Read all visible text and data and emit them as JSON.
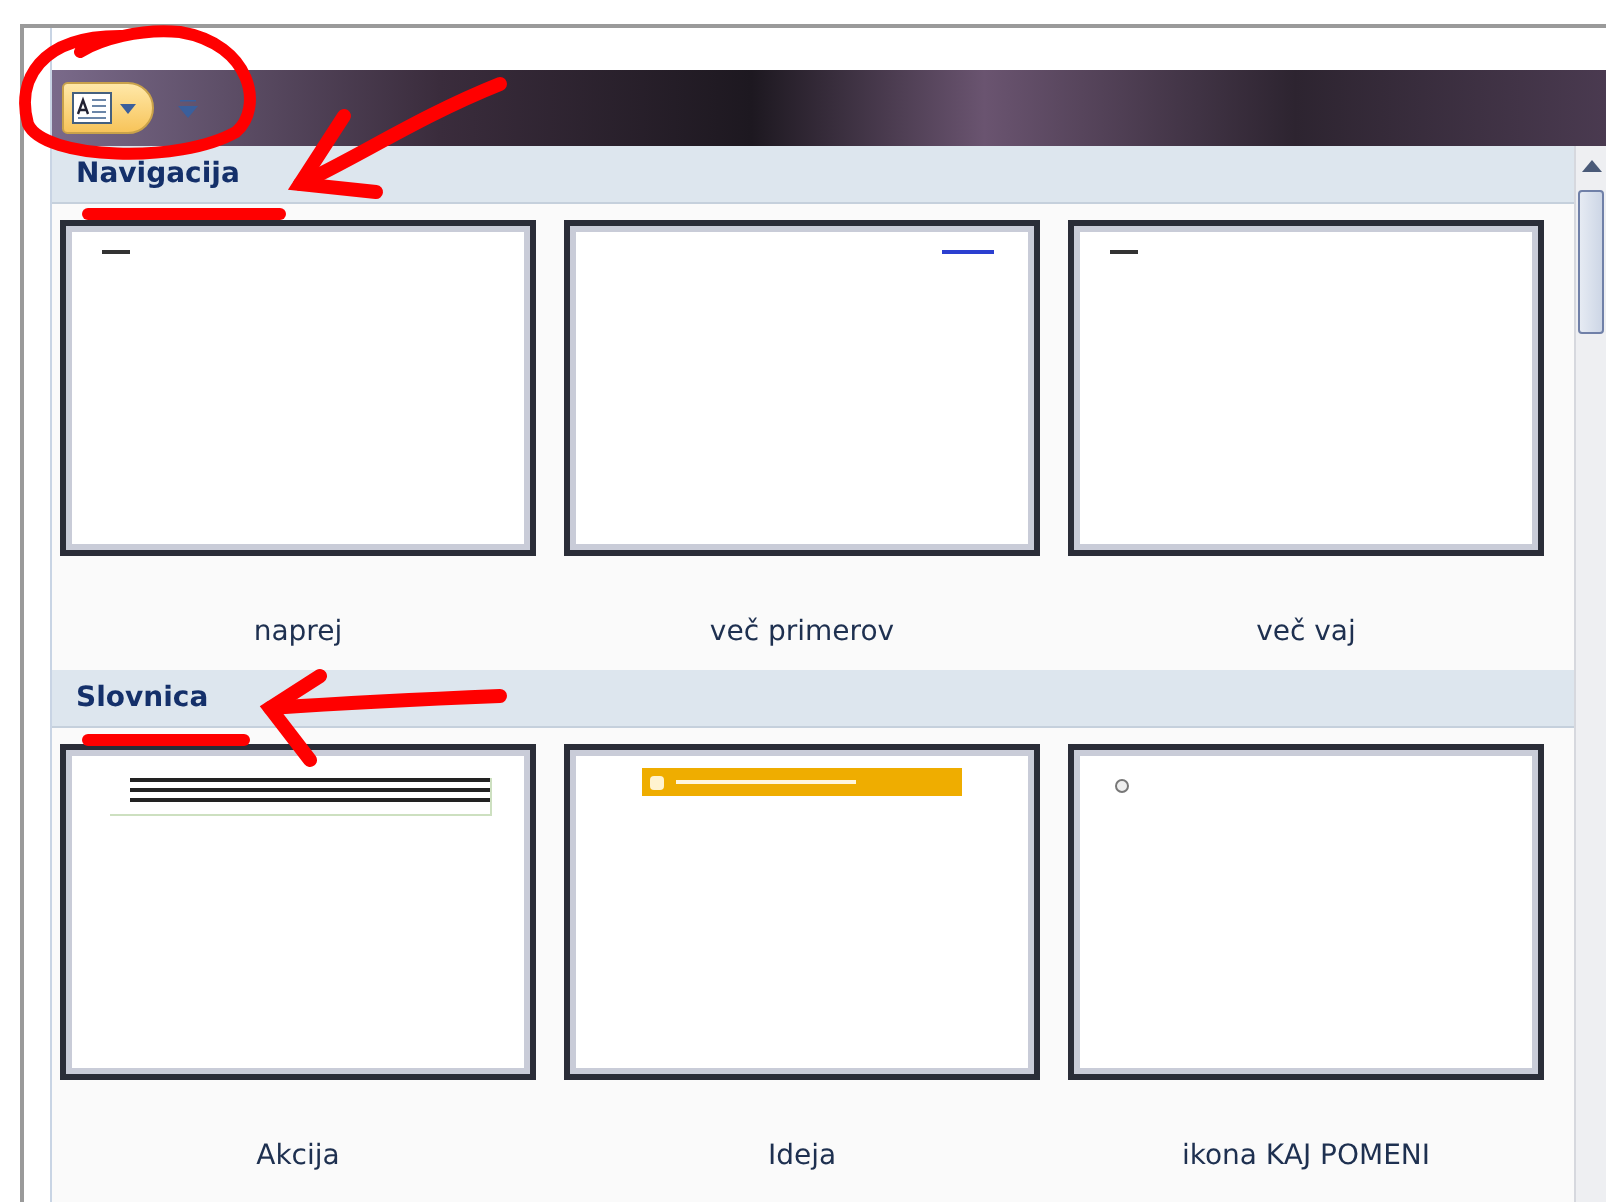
{
  "sections": [
    {
      "title": "Navigacija",
      "slides": [
        {
          "label": "naprej",
          "kind": "note-left"
        },
        {
          "label": "več primerov",
          "kind": "note-right"
        },
        {
          "label": "več vaj",
          "kind": "note-left"
        }
      ]
    },
    {
      "title": "Slovnica",
      "slides": [
        {
          "label": "Akcija",
          "kind": "paragraph"
        },
        {
          "label": "Ideja",
          "kind": "banner"
        },
        {
          "label": "ikona KAJ POMENI",
          "kind": "icon"
        }
      ]
    }
  ]
}
